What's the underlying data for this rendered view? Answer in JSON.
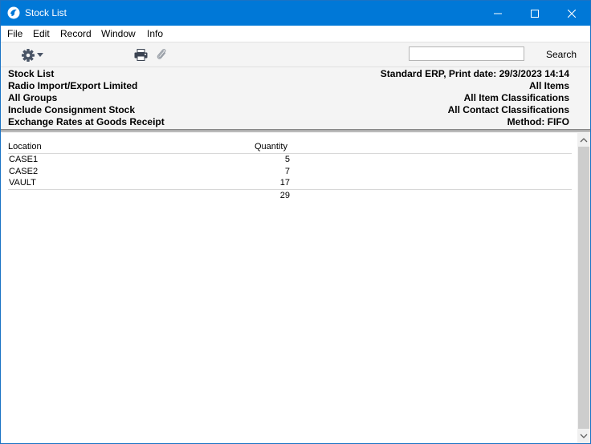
{
  "window": {
    "title": "Stock List"
  },
  "menu": [
    "File",
    "Edit",
    "Record",
    "Window",
    "Info"
  ],
  "toolbar": {
    "search_value": "",
    "search_label": "Search"
  },
  "report_header": {
    "left": [
      "Stock List",
      "Radio Import/Export Limited",
      "All Groups",
      "Include Consignment Stock",
      "Exchange Rates at Goods Receipt"
    ],
    "right": [
      "Standard ERP, Print date: 29/3/2023 14:14",
      "All Items",
      "All Item Classifications",
      "All Contact Classifications",
      "Method: FIFO"
    ]
  },
  "table": {
    "headers": {
      "location": "Location",
      "quantity": "Quantity"
    },
    "rows": [
      {
        "location": "CASE1",
        "quantity": "5"
      },
      {
        "location": "CASE2",
        "quantity": "7"
      },
      {
        "location": "VAULT",
        "quantity": "17"
      }
    ],
    "total": "29"
  },
  "colors": {
    "titlebar": "#0078d7",
    "panel": "#f4f4f4"
  },
  "icons": [
    "app-icon",
    "minimize-icon",
    "maximize-icon",
    "close-icon",
    "gear-icon",
    "dropdown-arrow-icon",
    "printer-icon",
    "paperclip-icon",
    "scroll-up-icon",
    "scroll-down-icon"
  ]
}
